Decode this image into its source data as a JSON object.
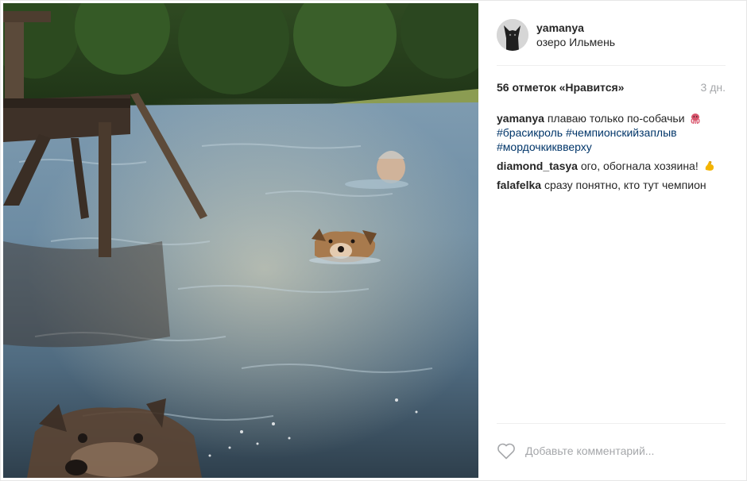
{
  "post": {
    "author": "yamanya",
    "location": "озеро Ильмень",
    "likes_text": "56 отметок «Нравится»",
    "time": "3 дн."
  },
  "comments": [
    {
      "user": "yamanya",
      "text": "плаваю только по-собачьи",
      "emoji": "octopus-emoji",
      "tags": [
        "#брасикроль",
        "#чемпионскийзаплыв",
        "#мордочкиквверху"
      ]
    },
    {
      "user": "diamond_tasya",
      "text": "ого, обогнала хозяина!",
      "emoji": "flexed-biceps-emoji"
    },
    {
      "user": "falafelka",
      "text": "сразу понятно, кто тут чемпион"
    }
  ],
  "add_comment": {
    "placeholder": "Добавьте комментарий..."
  },
  "icons": {
    "like": "heart-outline-icon"
  },
  "colors": {
    "hashtag": "#003569",
    "muted": "#a5a7aa",
    "text": "#262626",
    "divider": "#efefef"
  }
}
